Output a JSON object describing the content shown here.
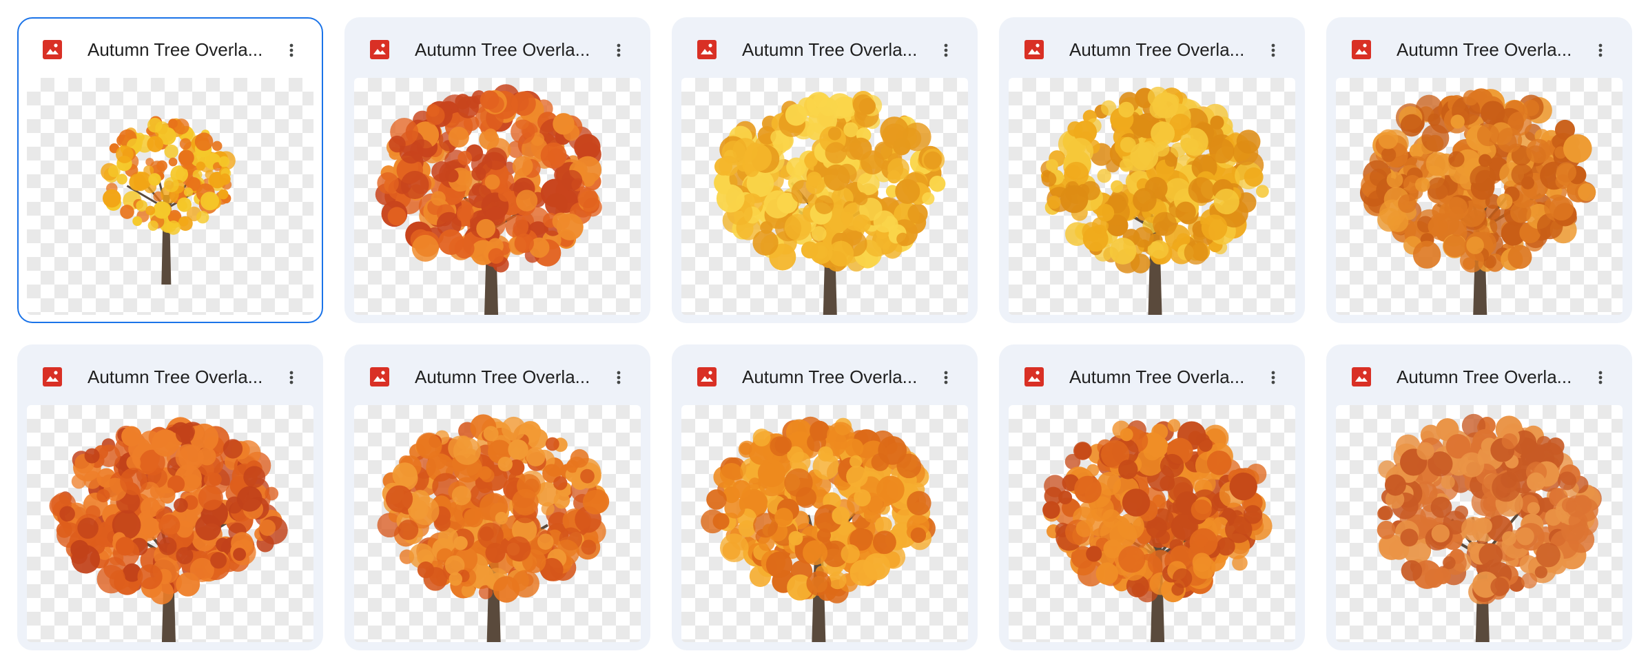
{
  "files": [
    {
      "title": "Autumn Tree Overla...",
      "icon": "image-file-icon",
      "palette": [
        "#e8731a",
        "#f2a516",
        "#f5c82a"
      ],
      "selected": true
    },
    {
      "title": "Autumn Tree Overla...",
      "icon": "image-file-icon",
      "palette": [
        "#c8441c",
        "#e2621f",
        "#ef8a2a"
      ]
    },
    {
      "title": "Autumn Tree Overla...",
      "icon": "image-file-icon",
      "palette": [
        "#e79a1c",
        "#f4b62a",
        "#fad54a"
      ]
    },
    {
      "title": "Autumn Tree Overla...",
      "icon": "image-file-icon",
      "palette": [
        "#de8c14",
        "#f0aa1c",
        "#f6c83a"
      ]
    },
    {
      "title": "Autumn Tree Overla...",
      "icon": "image-file-icon",
      "palette": [
        "#c95e16",
        "#de7820",
        "#ee9a30"
      ]
    },
    {
      "title": "Autumn Tree Overla...",
      "icon": "image-file-icon",
      "palette": [
        "#c2421a",
        "#de5e1c",
        "#ee7e28"
      ]
    },
    {
      "title": "Autumn Tree Overla...",
      "icon": "image-file-icon",
      "palette": [
        "#d6561a",
        "#e8761e",
        "#f29a34"
      ]
    },
    {
      "title": "Autumn Tree Overla...",
      "icon": "image-file-icon",
      "palette": [
        "#dd6a18",
        "#ee8a1e",
        "#f6ae30"
      ]
    },
    {
      "title": "Autumn Tree Overla...",
      "icon": "image-file-icon",
      "palette": [
        "#c64a18",
        "#e0681c",
        "#f08e26"
      ]
    },
    {
      "title": "Autumn Tree Overla...",
      "icon": "image-file-icon",
      "palette": [
        "#c85a24",
        "#dd7432",
        "#ea9446"
      ]
    }
  ],
  "colors": {
    "card_bg": "#eef2f9",
    "selected_border": "#1a73e8",
    "image_icon_red": "#d93025",
    "title_text": "#1f1f1f"
  }
}
